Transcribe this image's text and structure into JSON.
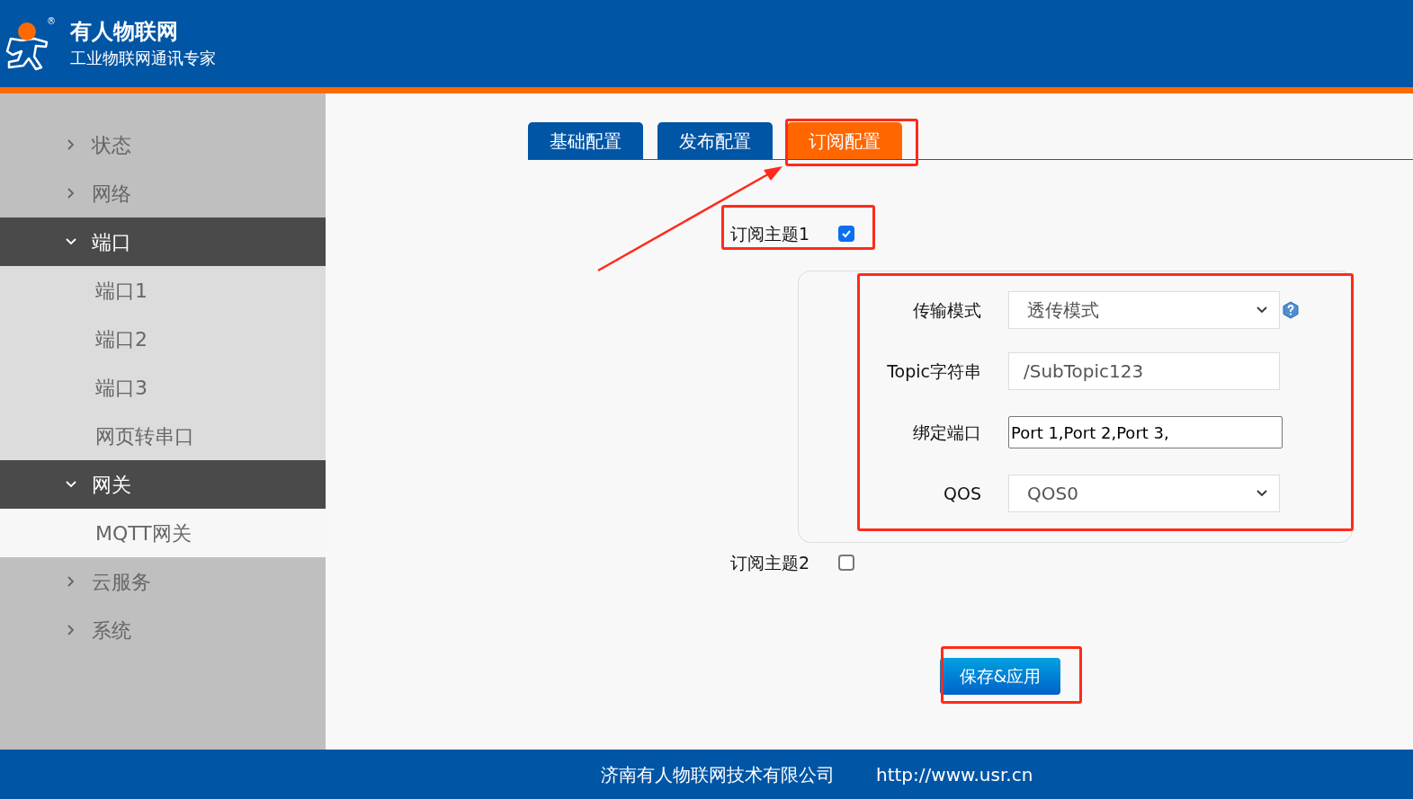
{
  "header": {
    "brand": "有人物联网",
    "slogan": "工业物联网通讯专家",
    "registered_mark": "®"
  },
  "sidebar": {
    "items": [
      {
        "label": "状态",
        "expanded": false
      },
      {
        "label": "网络",
        "expanded": false
      },
      {
        "label": "端口",
        "expanded": true,
        "children": [
          {
            "label": "端口1",
            "selected": false
          },
          {
            "label": "端口2",
            "selected": false
          },
          {
            "label": "端口3",
            "selected": false
          },
          {
            "label": "网页转串口",
            "selected": false
          }
        ]
      },
      {
        "label": "网关",
        "expanded": true,
        "children": [
          {
            "label": "MQTT网关",
            "selected": true
          }
        ]
      },
      {
        "label": "云服务",
        "expanded": false
      },
      {
        "label": "系统",
        "expanded": false
      }
    ]
  },
  "tabs": [
    {
      "label": "基础配置",
      "selected": false
    },
    {
      "label": "发布配置",
      "selected": false
    },
    {
      "label": "订阅配置",
      "selected": true
    }
  ],
  "topics": [
    {
      "label": "订阅主题1",
      "checked": true,
      "fields": [
        {
          "kind": "select",
          "label": "传输模式",
          "value": "透传模式",
          "help": true
        },
        {
          "kind": "text",
          "label": "Topic字符串",
          "value": "/SubTopic123"
        },
        {
          "kind": "input",
          "label": "绑定端口",
          "value": "Port 1,Port 2,Port 3,"
        },
        {
          "kind": "select",
          "label": "QOS",
          "value": "QOS0"
        }
      ]
    },
    {
      "label": "订阅主题2",
      "checked": false
    }
  ],
  "save_button": "保存&应用",
  "footer": {
    "company": "济南有人物联网技术有限公司",
    "url": "http://www.usr.cn"
  }
}
